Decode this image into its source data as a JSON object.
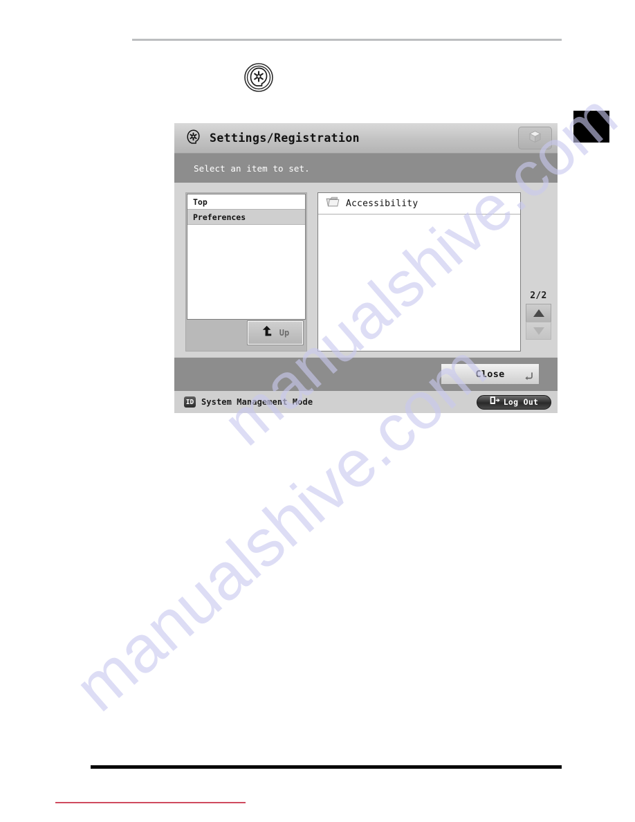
{
  "page": {
    "tab_marker": "",
    "hardware_key_icon": "settings-registration-key-icon"
  },
  "watermark": {
    "line1": "manualshive.com",
    "line2": "manualshive.com",
    "color": "#c9c9ef"
  },
  "device": {
    "titlebar": {
      "icon": "settings-registration-icon",
      "title": "Settings/Registration",
      "cube_button_icon": "cube-icon"
    },
    "messagebar": {
      "text": "Select an item to set."
    },
    "tree": {
      "items": [
        {
          "label": "Top",
          "selected": false
        },
        {
          "label": "Preferences",
          "selected": true
        }
      ],
      "up_button": {
        "label": "Up",
        "icon": "arrow-up-left-icon"
      }
    },
    "list": {
      "items": [
        {
          "label": "Accessibility",
          "icon": "folder-icon"
        }
      ]
    },
    "scroll": {
      "page_indicator": "2/2",
      "up_icon": "triangle-up-icon",
      "down_icon": "triangle-down-icon",
      "up_enabled": true,
      "down_enabled": false
    },
    "actionbar": {
      "close_label": "Close",
      "enter_glyph": "⏎"
    },
    "statusbar": {
      "id_badge": "ID",
      "mode_text": "System Management Mode",
      "logout_label": "Log Out",
      "logout_icon": "exit-door-icon"
    }
  },
  "colors": {
    "panel_bg": "#d4d4d4",
    "messagebar_bg": "#8d8d8d",
    "actionbar_bg": "#8d8d8d",
    "statusbar_bg": "#d0d0d0",
    "selected_row": "#cfcfcf",
    "rule_top": "#bcbec0",
    "rule_bottom": "#000000",
    "rule_red": "#cf4a5e"
  }
}
